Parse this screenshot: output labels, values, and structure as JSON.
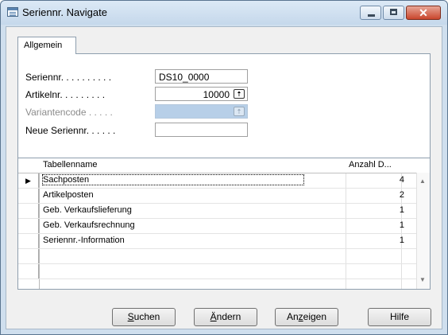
{
  "window": {
    "title": "Seriennr. Navigate",
    "controls": [
      "minimize-icon",
      "maximize-icon",
      "close-icon"
    ],
    "close_glyph": "✕"
  },
  "tab": {
    "label": "Allgemein"
  },
  "fields": [
    {
      "label": "Seriennr. . . . . . . . . .",
      "value": "DS10_0000",
      "enabled": true
    },
    {
      "label": "Artikelnr. . . . . . . . .",
      "value": "10000",
      "enabled": true,
      "lookup": true
    },
    {
      "label": "Variantencode . . . . .",
      "value": "",
      "enabled": false,
      "lookup": true
    },
    {
      "label": "Neue Seriennr. . . . . .",
      "value": "",
      "enabled": true
    }
  ],
  "lookup_glyph": "🠅",
  "table": {
    "columns": [
      "Tabellenname",
      "Anzahl D..."
    ],
    "current_row_marker": "▶",
    "rows": [
      {
        "name": "Sachposten",
        "count": "4"
      },
      {
        "name": "Artikelposten",
        "count": "2"
      },
      {
        "name": "Geb. Verkaufslieferung",
        "count": "1"
      },
      {
        "name": "Geb. Verkaufsrechnung",
        "count": "1"
      },
      {
        "name": "Seriennr.-Information",
        "count": "1"
      }
    ],
    "scroll_up": "▲",
    "scroll_down": "▼"
  },
  "buttons": {
    "suchen": {
      "pre": "",
      "key": "S",
      "post": "uchen"
    },
    "aendern": {
      "pre": "",
      "key": "Ä",
      "post": "ndern"
    },
    "anzeigen": {
      "pre": "An",
      "key": "z",
      "post": "eigen"
    },
    "hilfe": {
      "pre": "Hilfe",
      "key": "",
      "post": ""
    }
  }
}
